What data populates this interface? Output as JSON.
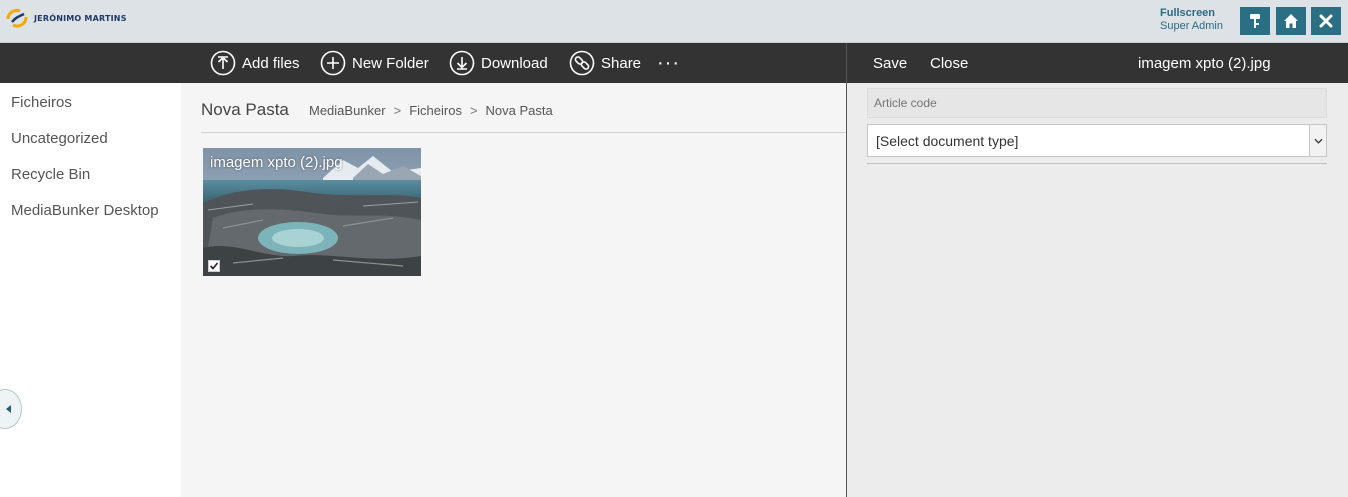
{
  "header": {
    "logo_text": "JERÓNIMO MARTINS",
    "fullscreen_label": "Fullscreen",
    "user_role": "Super Admin",
    "buttons": [
      {
        "name": "key-button",
        "icon": "key-icon"
      },
      {
        "name": "home-button",
        "icon": "home-icon"
      },
      {
        "name": "close-button",
        "icon": "close-icon"
      }
    ],
    "accent_color": "#2b6f85"
  },
  "toolbar": {
    "add_files": "Add files",
    "new_folder": "New Folder",
    "download": "Download",
    "share": "Share",
    "more": "···"
  },
  "right_toolbar": {
    "save": "Save",
    "close": "Close",
    "file_title": "imagem xpto (2).jpg"
  },
  "sidebar": {
    "items": [
      {
        "label": "Ficheiros"
      },
      {
        "label": "Uncategorized"
      },
      {
        "label": "Recycle Bin"
      },
      {
        "label": "MediaBunker Desktop"
      }
    ]
  },
  "main": {
    "folder_title": "Nova Pasta",
    "breadcrumb": [
      "MediaBunker",
      "Ficheiros",
      "Nova Pasta"
    ],
    "breadcrumb_sep": ">",
    "files": [
      {
        "name": "imagem xpto (2).jpg",
        "selected": true
      }
    ]
  },
  "details": {
    "article_code_placeholder": "Article code",
    "doc_type_value": "[Select document type]"
  }
}
